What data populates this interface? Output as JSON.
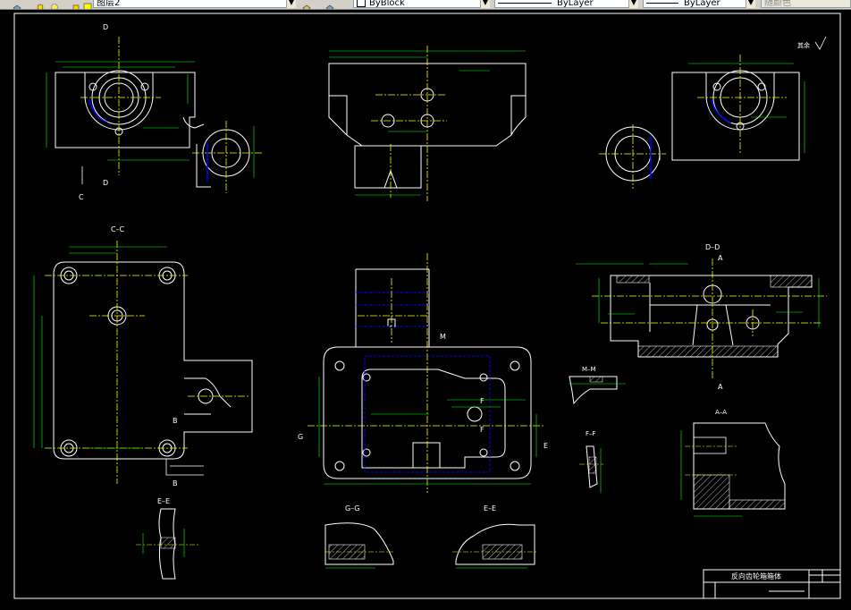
{
  "toolbar": {
    "layer_name": "图层2",
    "color_value": "ByBlock",
    "linetype_value": "ByLayer",
    "lineweight_value": "ByLayer",
    "plotstyle_value": "随颜色"
  },
  "drawing": {
    "section_labels": {
      "c_c": "C–C",
      "d_d": "D–D",
      "a_a": "A–A",
      "m_m": "M–M",
      "f_f": "F–F",
      "e_e": "E–E",
      "g_g": "G–G"
    },
    "markers": {
      "d": "D",
      "c": "C",
      "a": "A",
      "b": "B",
      "m": "M",
      "g": "G",
      "e": "E",
      "f": "F"
    },
    "roughness_note": "其余",
    "title_block": {
      "title": "反向齿轮箱箱体"
    }
  },
  "colors": {
    "background": "#000000",
    "outline": "#ffffff",
    "centerline": "#ffff00",
    "dimension": "#00ff00",
    "hidden": "#0000ff"
  }
}
